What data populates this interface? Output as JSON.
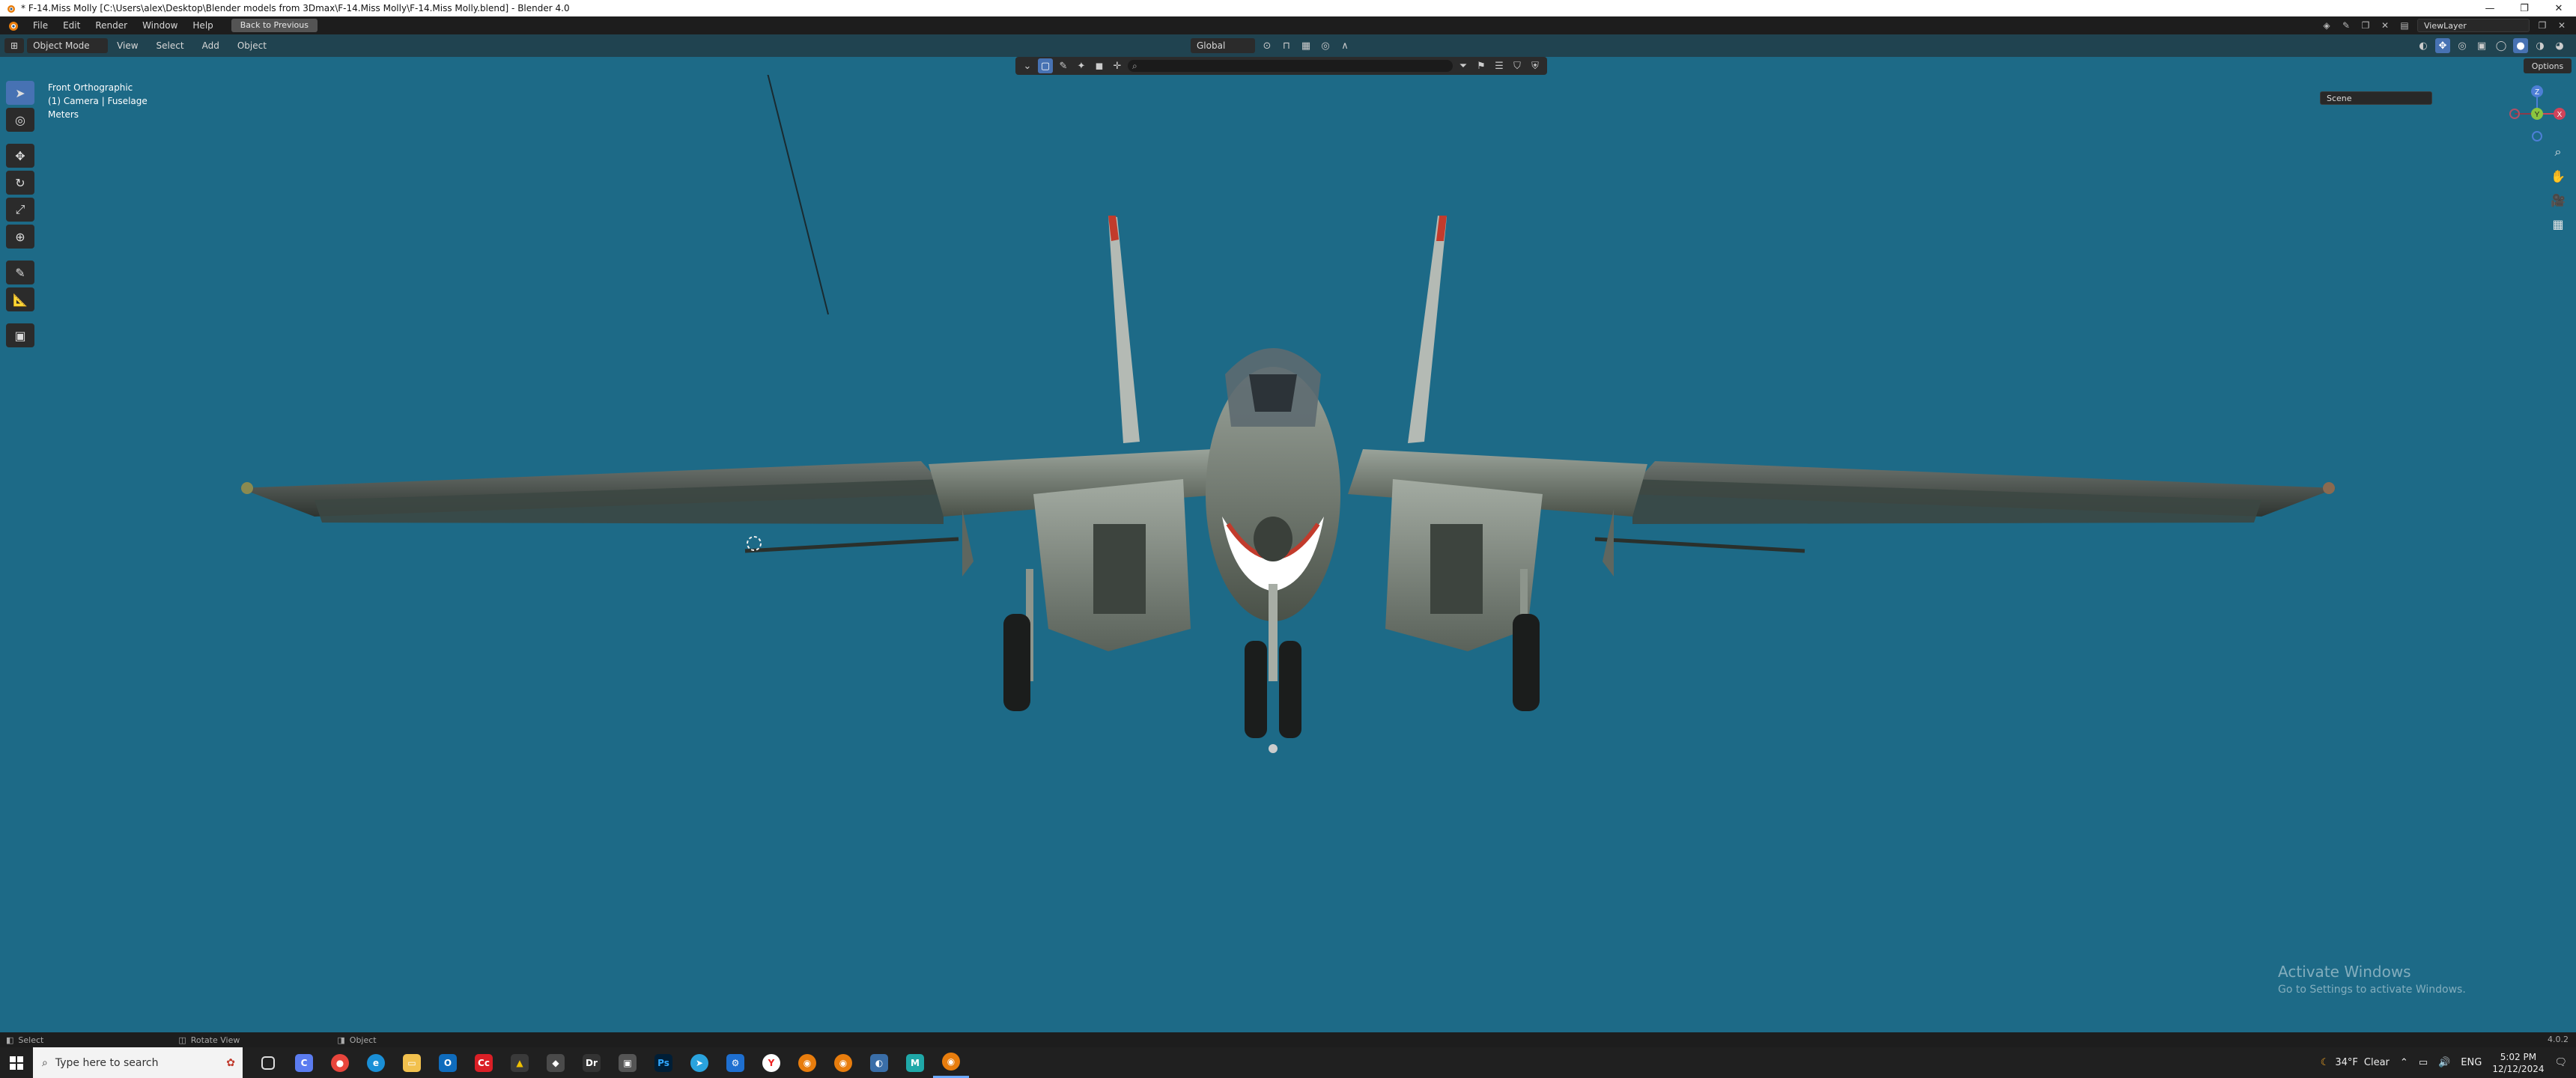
{
  "window": {
    "title": "* F-14.Miss Molly [C:\\Users\\alex\\Desktop\\Blender models from 3Dmax\\F-14.Miss Molly\\F-14.Miss Molly.blend] - Blender 4.0",
    "minimize": "—",
    "maximize": "❐",
    "close": "✕"
  },
  "menubar": {
    "items": [
      "File",
      "Edit",
      "Render",
      "Window",
      "Help"
    ],
    "back_label": "Back to Previous",
    "scene_label": "Scene",
    "viewlayer_label": "ViewLayer"
  },
  "viewport_header": {
    "mode_label": "Object Mode",
    "menus": [
      "View",
      "Select",
      "Add",
      "Object"
    ],
    "orientation_label": "Global",
    "options_label": "Options"
  },
  "overlay": {
    "view_name": "Front Orthographic",
    "collection": "(1) Camera | Fuselage",
    "units": "Meters"
  },
  "gizmo": {
    "z_label": "Z",
    "y_label": "Y",
    "x_label": "X"
  },
  "watermark": {
    "line1": "Activate Windows",
    "line2": "Go to Settings to activate Windows."
  },
  "statusbar": {
    "select_label": "Select",
    "rotate_label": "Rotate View",
    "object_label": "Object",
    "version": "4.0.2"
  },
  "taskbar": {
    "search_placeholder": "Type here to search",
    "weather_temp": "34°F",
    "weather_desc": "Clear",
    "language": "ENG",
    "time": "5:02 PM",
    "date": "12/12/2024"
  }
}
